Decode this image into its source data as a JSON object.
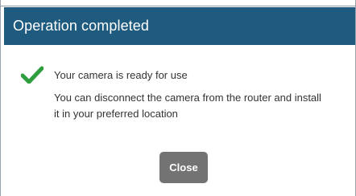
{
  "dialog": {
    "title": "Operation completed",
    "status_text": "Your camera is ready for use",
    "message": "You can disconnect the camera from the router and install it in your preferred location",
    "close_label": "Close",
    "success_icon": "check-icon"
  },
  "colors": {
    "header_background": "#1f5b7f",
    "check_icon": "#2f9e3f",
    "button_background": "#737373",
    "text": "#333333"
  }
}
